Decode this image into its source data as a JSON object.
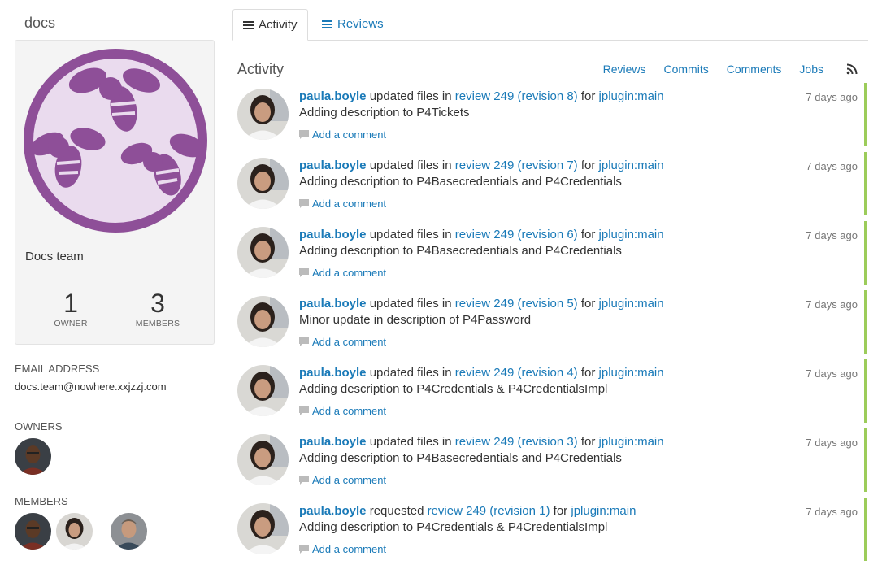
{
  "sidebar": {
    "group_id": "docs",
    "group_name": "Docs team",
    "owners_count": "1",
    "owners_label": "OWNER",
    "members_count": "3",
    "members_label": "MEMBERS",
    "email_heading": "EMAIL ADDRESS",
    "email": "docs.team@nowhere.xxjzzj.com",
    "owners_heading": "OWNERS",
    "members_heading": "MEMBERS"
  },
  "tabs": [
    {
      "label": "Activity",
      "active": true
    },
    {
      "label": "Reviews",
      "active": false
    }
  ],
  "activity": {
    "title": "Activity",
    "filters": [
      "Reviews",
      "Commits",
      "Comments",
      "Jobs"
    ],
    "add_comment_label": "Add a comment",
    "items": [
      {
        "user": "paula.boyle",
        "action": "updated files in",
        "target": "review 249 (revision 8)",
        "for": "for",
        "project": "jplugin:main",
        "description": "Adding description to P4Tickets",
        "time": "7 days ago"
      },
      {
        "user": "paula.boyle",
        "action": "updated files in",
        "target": "review 249 (revision 7)",
        "for": "for",
        "project": "jplugin:main",
        "description": "Adding description to P4Basecredentials and P4Credentials",
        "time": "7 days ago"
      },
      {
        "user": "paula.boyle",
        "action": "updated files in",
        "target": "review 249 (revision 6)",
        "for": "for",
        "project": "jplugin:main",
        "description": "Adding description to P4Basecredentials and P4Credentials",
        "time": "7 days ago"
      },
      {
        "user": "paula.boyle",
        "action": "updated files in",
        "target": "review 249 (revision 5)",
        "for": "for",
        "project": "jplugin:main",
        "description": "Minor update in description of P4Password",
        "time": "7 days ago"
      },
      {
        "user": "paula.boyle",
        "action": "updated files in",
        "target": "review 249 (revision 4)",
        "for": "for",
        "project": "jplugin:main",
        "description": "Adding description to P4Credentials & P4CredentialsImpl",
        "time": "7 days ago"
      },
      {
        "user": "paula.boyle",
        "action": "updated files in",
        "target": "review 249 (revision 3)",
        "for": "for",
        "project": "jplugin:main",
        "description": "Adding description to P4Basecredentials and P4Credentials",
        "time": "7 days ago"
      },
      {
        "user": "paula.boyle",
        "action": "requested",
        "target": "review 249 (revision 1)",
        "for": "for",
        "project": "jplugin:main",
        "description": "Adding description to P4Credentials & P4CredentialsImpl",
        "time": "7 days ago"
      }
    ]
  },
  "colors": {
    "link": "#1a7ab8",
    "status_bar": "#9ccc5a",
    "group_avatar_purple": "#8e4f98",
    "group_avatar_bg": "#eadbee"
  },
  "icons": {
    "tab_activity": "list-icon",
    "tab_reviews": "list-icon",
    "rss": "rss-icon",
    "comment": "comment-bubble-icon"
  }
}
